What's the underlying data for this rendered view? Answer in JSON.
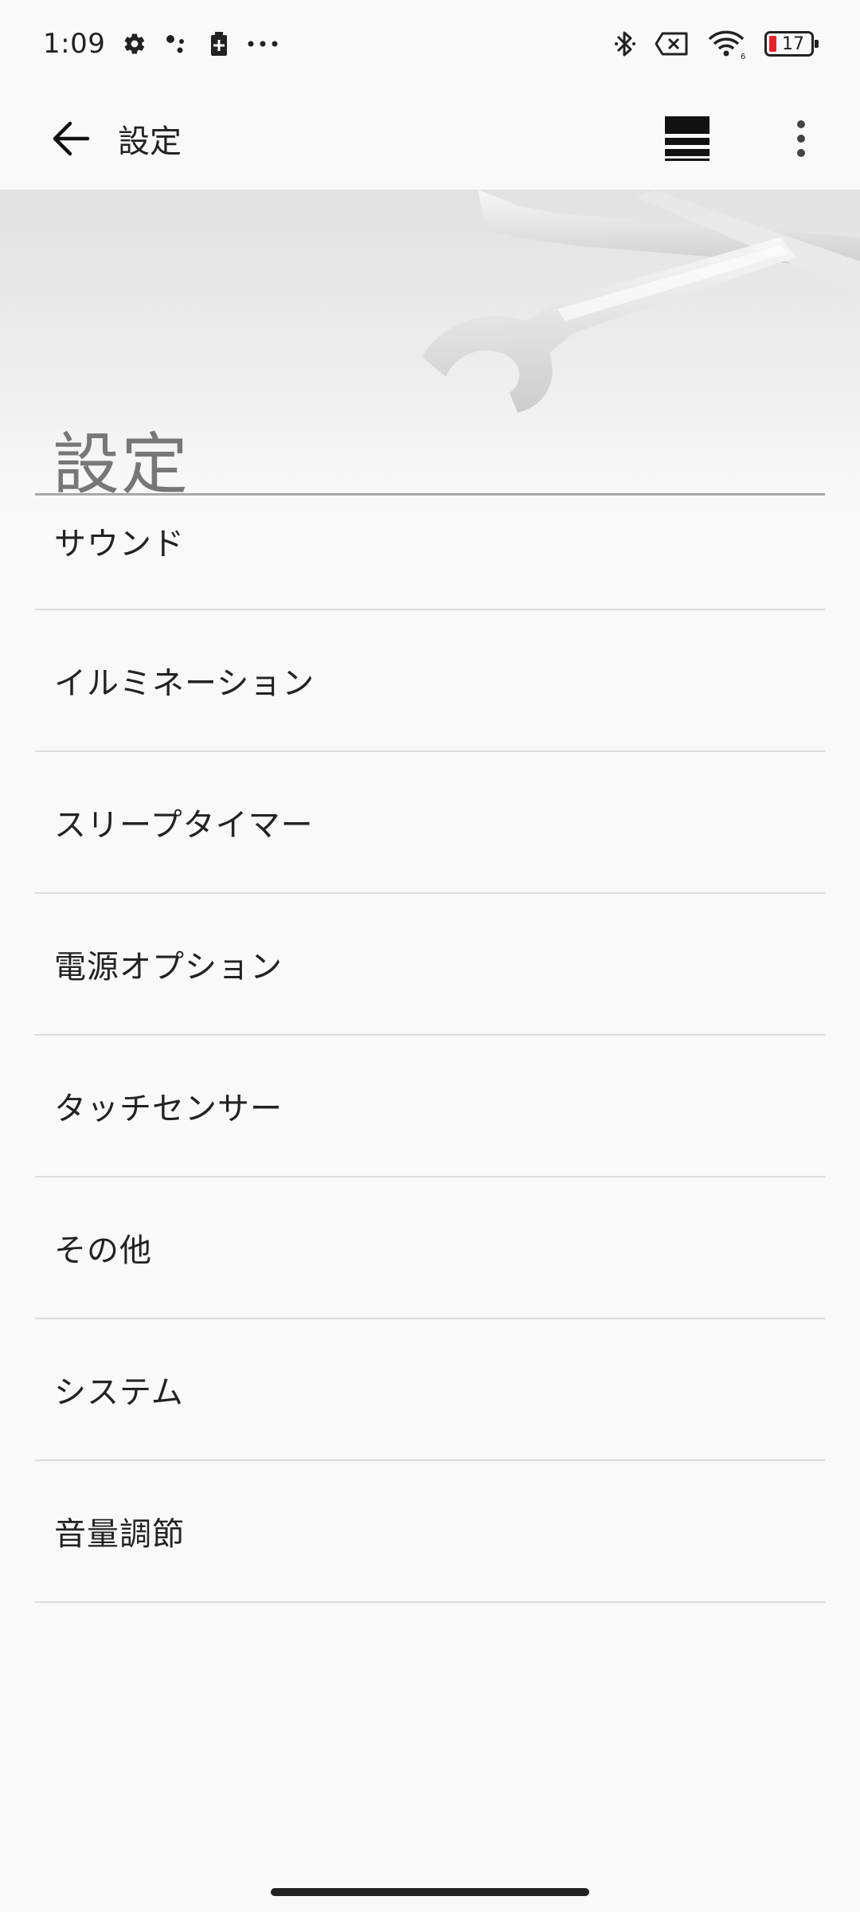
{
  "status_bar": {
    "time": "1:09",
    "battery_level": "17",
    "battery_color": "#e0262b",
    "icons": [
      "settings-gear-icon",
      "assistant-dots-icon",
      "battery-saver-icon",
      "more-notifications-icon",
      "bluetooth-icon",
      "no-sim-icon",
      "wifi-icon",
      "battery-icon"
    ]
  },
  "app_bar": {
    "title": "設定",
    "icons": [
      "back-arrow-icon",
      "grid-view-icon",
      "more-vert-icon"
    ]
  },
  "banner": {
    "title": "設定"
  },
  "settings_list": {
    "items": [
      {
        "label": "サウンド"
      },
      {
        "label": "イルミネーション"
      },
      {
        "label": "スリープタイマー"
      },
      {
        "label": "電源オプション"
      },
      {
        "label": "タッチセンサー"
      },
      {
        "label": "その他"
      },
      {
        "label": "システム"
      },
      {
        "label": "音量調節"
      }
    ]
  }
}
